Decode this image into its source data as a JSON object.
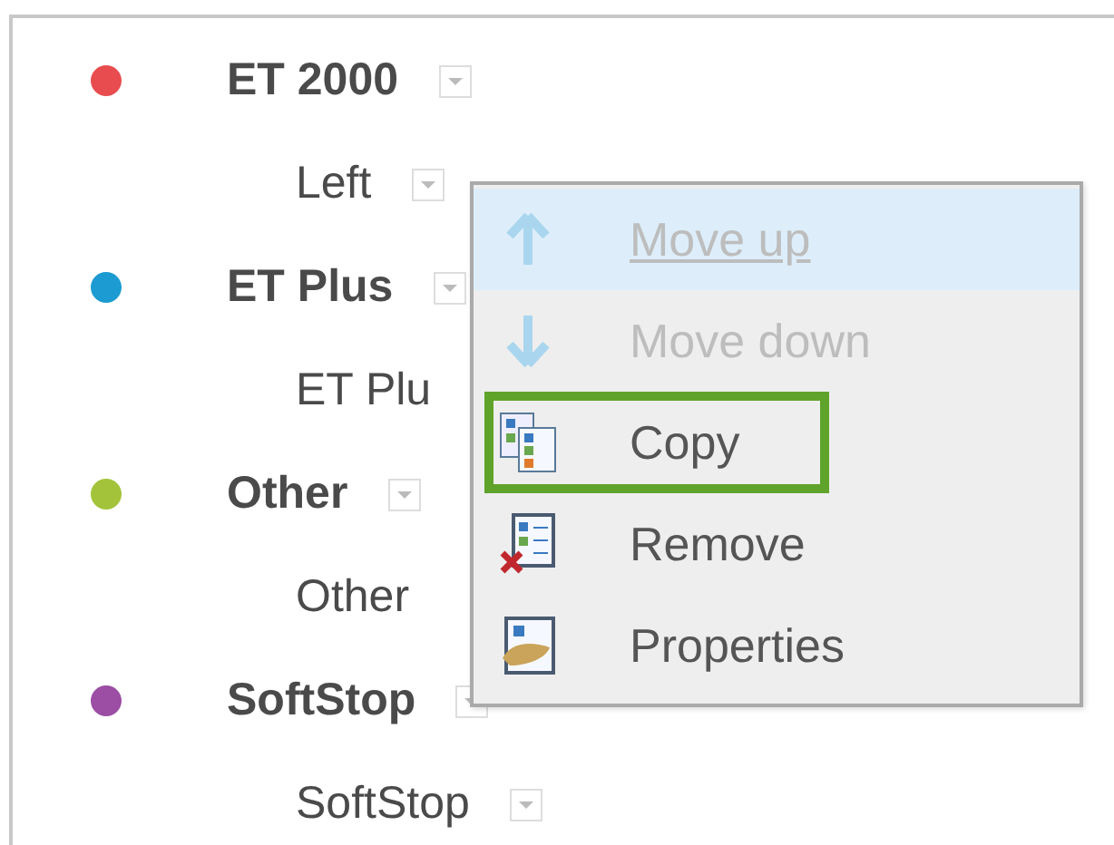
{
  "groups": [
    {
      "label": "ET 2000",
      "color": "#e84c4f",
      "dropdown": true,
      "sub": {
        "label": "Left",
        "dropdown": true
      }
    },
    {
      "label": "ET Plus",
      "color": "#1b9bd1",
      "dropdown": true,
      "sub": {
        "label": "ET Plu",
        "dropdown": false
      }
    },
    {
      "label": "Other",
      "color": "#a3c43a",
      "dropdown": true,
      "sub": {
        "label": "Other",
        "dropdown": false
      }
    },
    {
      "label": "SoftStop",
      "color": "#9b4ea3",
      "dropdown": true,
      "sub": {
        "label": "SoftStop",
        "dropdown": true
      }
    }
  ],
  "context_menu": {
    "items": [
      {
        "kind": "up",
        "label": "Move up",
        "selected": true,
        "disabled": true,
        "highlighted": false
      },
      {
        "kind": "down",
        "label": "Move down",
        "selected": false,
        "disabled": true,
        "highlighted": false
      },
      {
        "kind": "copy",
        "label": "Copy",
        "selected": false,
        "disabled": false,
        "highlighted": true
      },
      {
        "kind": "remove",
        "label": "Remove",
        "selected": false,
        "disabled": false,
        "highlighted": false
      },
      {
        "kind": "properties",
        "label": "Properties",
        "selected": false,
        "disabled": false,
        "highlighted": false
      }
    ]
  }
}
